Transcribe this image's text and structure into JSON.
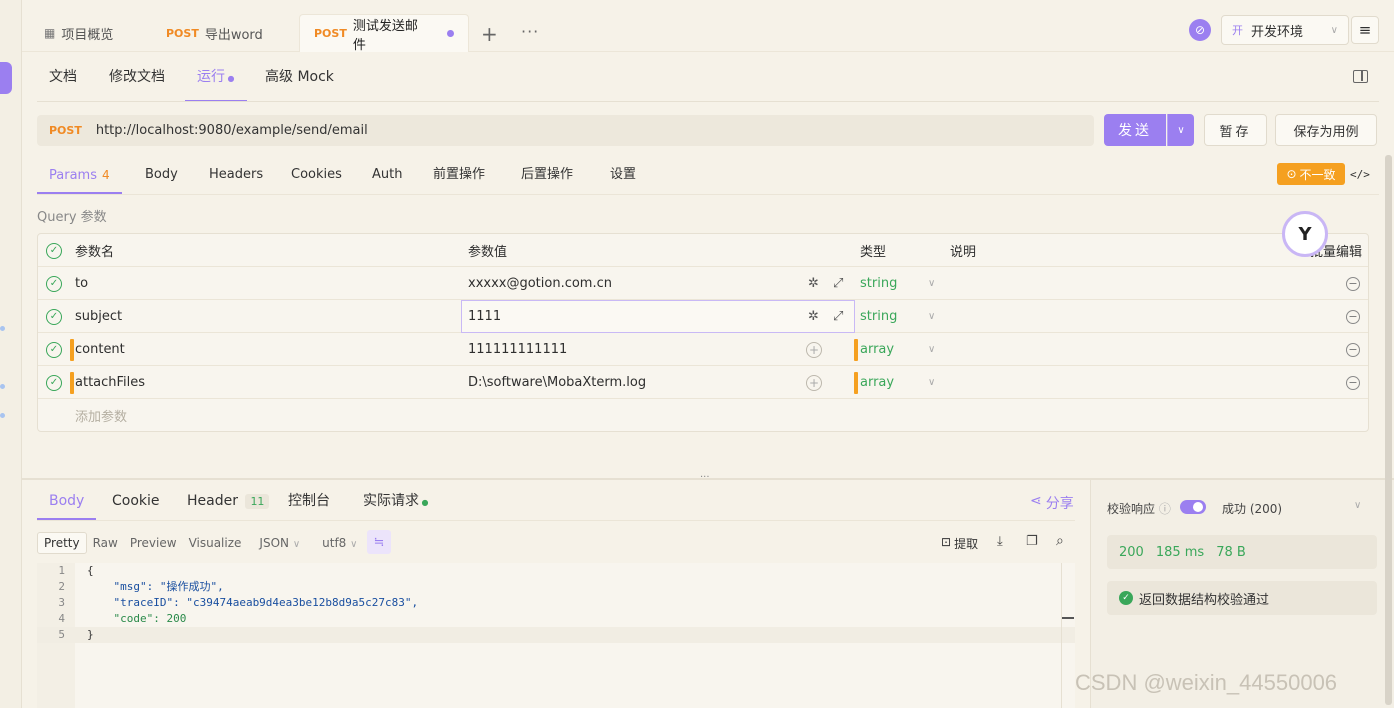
{
  "tabs": [
    {
      "icon": "grid-icon",
      "label": "项目概览"
    },
    {
      "method": "POST",
      "label": "导出word"
    },
    {
      "method": "POST",
      "label": "测试发送邮件"
    }
  ],
  "env": {
    "badge": "开",
    "label": "开发环境"
  },
  "sub_nav": [
    "文档",
    "修改文档",
    "运行",
    "高级 Mock"
  ],
  "request": {
    "method": "POST",
    "url": "http://localhost:9080/example/send/email"
  },
  "buttons": {
    "send": "发送",
    "save_temp": "暂存",
    "save_case": "保存为用例"
  },
  "param_tabs": {
    "params": "Params",
    "params_count": "4",
    "body": "Body",
    "headers": "Headers",
    "cookies": "Cookies",
    "auth": "Auth",
    "pre": "前置操作",
    "post": "后置操作",
    "settings": "设置"
  },
  "mismatch_badge": "不一致",
  "query_title": "Query 参数",
  "table_headers": {
    "name": "参数名",
    "value": "参数值",
    "type": "类型",
    "desc": "说明",
    "bulk": "批量编辑"
  },
  "params": [
    {
      "name": "to",
      "value": "xxxxx@gotion.com.cn",
      "type": "string"
    },
    {
      "name": "subject",
      "value": "1111",
      "type": "string"
    },
    {
      "name": "content",
      "value": "111111111111",
      "type": "array"
    },
    {
      "name": "attachFiles",
      "value": "D:\\software\\MobaXterm.log",
      "type": "array"
    }
  ],
  "add_param_placeholder": "添加参数",
  "response_tabs": {
    "body": "Body",
    "cookie": "Cookie",
    "header": "Header",
    "header_count": "11",
    "console": "控制台",
    "actual": "实际请求"
  },
  "share": "分享",
  "formats": [
    "Pretty",
    "Raw",
    "Preview",
    "Visualize"
  ],
  "format_select": "JSON",
  "encoding_select": "utf8",
  "extract": "提取",
  "code_lines": [
    {
      "n": "1",
      "text": "{"
    },
    {
      "n": "2",
      "text": "    \"msg\": \"操作成功\","
    },
    {
      "n": "3",
      "text": "    \"traceID\": \"c39474aeab9d4ea3be12b8d9a5c27c83\","
    },
    {
      "n": "4",
      "text": "    \"code\": 200"
    },
    {
      "n": "5",
      "text": "}"
    }
  ],
  "validation": {
    "label": "校验响应",
    "result": "成功 (200)",
    "status": "200",
    "time": "185 ms",
    "size": "78 B",
    "message": "返回数据结构校验通过"
  },
  "watermark": "CSDN @weixin_44550006",
  "colors": {
    "accent": "#9b7ff0",
    "success": "#3aa75a",
    "warning": "#f5a020"
  }
}
